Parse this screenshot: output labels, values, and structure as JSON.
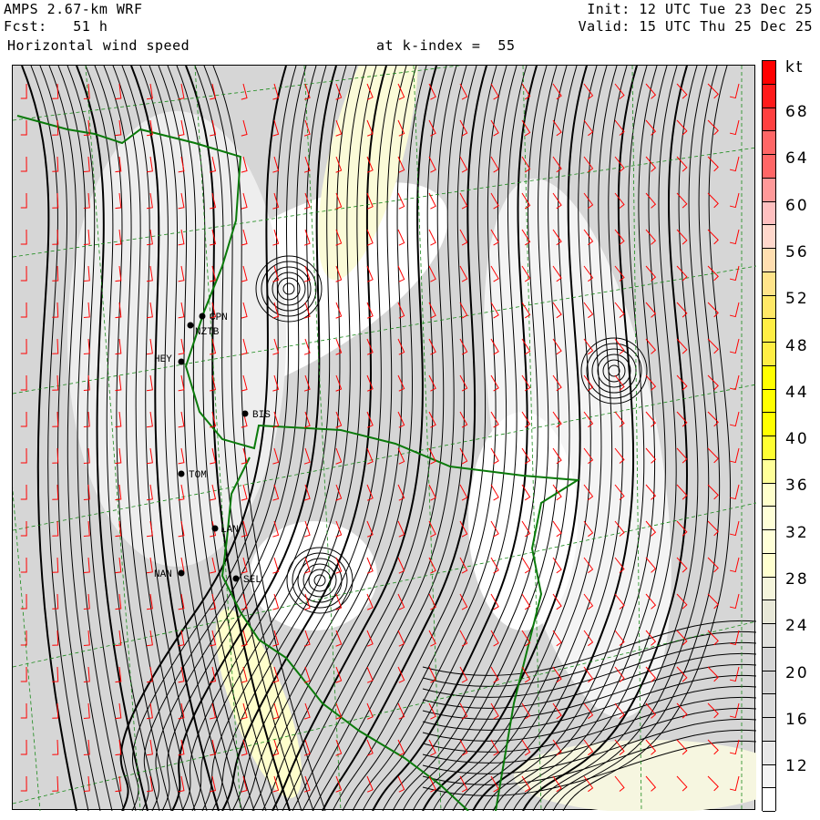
{
  "header": {
    "model": "AMPS 2.67-km WRF",
    "forecast": "Fcst:   51 h",
    "field": "Horizontal wind speed",
    "level": "at k-index =  55",
    "init": "Init: 12 UTC Tue 23 Dec 25",
    "valid": "Valid: 15 UTC Thu 25 Dec 25"
  },
  "colorbar": {
    "unit": "kt",
    "labels": [
      "68",
      "64",
      "60",
      "56",
      "52",
      "48",
      "44",
      "40",
      "36",
      "32",
      "28",
      "24",
      "20",
      "16",
      "12"
    ],
    "colors": [
      "#ff0000",
      "#ff1a1a",
      "#ff4040",
      "#ff6666",
      "#ff9999",
      "#ffc0c0",
      "#ffd8cc",
      "#ffdeb0",
      "#ffe59a",
      "#ffe566",
      "#ffea50",
      "#ffee40",
      "#ffee22",
      "#ffff00",
      "#ffff00",
      "#ffff00",
      "#ffff33",
      "#ffff99",
      "#ffffcc",
      "#ffffd6",
      "#ffffd0",
      "#f5f5dc",
      "#e8e8d8",
      "#e0e0e0",
      "#d4d4d4",
      "#d4d4d4",
      "#dedede",
      "#e8e8e8",
      "#f4f4f4",
      "#ffffff"
    ]
  },
  "stations": [
    "CPN",
    "NZTB",
    "HEY",
    "BIS",
    "TOM",
    "LAN",
    "NAN",
    "SEL"
  ]
}
